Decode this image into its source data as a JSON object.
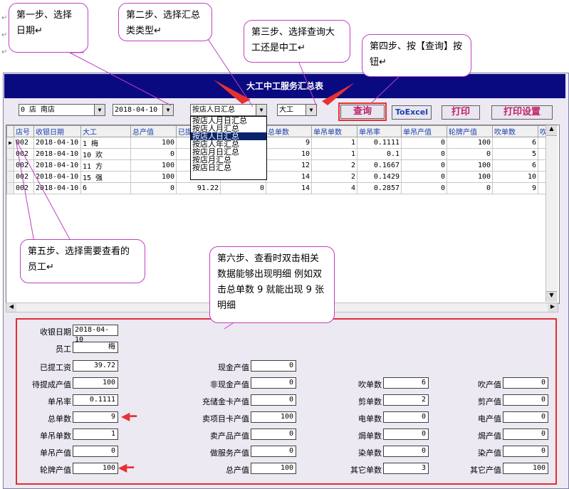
{
  "markers": [
    "↵",
    "↵",
    "↵"
  ],
  "window": {
    "title": "大工中工服务汇总表",
    "store_combo": "0   店 南店",
    "date_combo": "2018-04-10",
    "summary_combo": "按店人日汇总",
    "staff_combo": "大工",
    "buttons": {
      "query": "查询",
      "excel": "ToExcel",
      "print": "打印",
      "print_setup": "打印设置"
    },
    "summary_options": [
      "按店人月日汇总",
      "按店人月汇总",
      "按店人日汇总",
      "按店人年汇总",
      "按店月日汇总",
      "按店月汇总",
      "按店日汇总"
    ]
  },
  "grid": {
    "columns": [
      "店号",
      "收银日期",
      "大工",
      "总产值",
      "已提",
      "",
      "总单数",
      "单吊单数",
      "单吊率",
      "单吊产值",
      "轮牌产值",
      "吹单数",
      "吹"
    ],
    "rows": [
      [
        "002",
        "2018-04-10",
        "1   梅",
        "100",
        "",
        "",
        "9",
        "1",
        "0.1111",
        "0",
        "100",
        "6",
        ""
      ],
      [
        "002",
        "2018-04-10",
        "10  欢",
        "0",
        "",
        "",
        "10",
        "1",
        "0.1",
        "0",
        "0",
        "5",
        ""
      ],
      [
        "002",
        "2018-04-10",
        "11  方",
        "100",
        "",
        "",
        "12",
        "2",
        "0.1667",
        "0",
        "100",
        "6",
        ""
      ],
      [
        "002",
        "2018-04-10",
        "15  强",
        "100",
        "83.44",
        "100",
        "14",
        "2",
        "0.1429",
        "0",
        "100",
        "10",
        ""
      ],
      [
        "002",
        "2018-04-10",
        "6   ",
        "0",
        "91.22",
        "0",
        "14",
        "4",
        "0.2857",
        "0",
        "0",
        "9",
        ""
      ]
    ]
  },
  "detail": {
    "date_label": "收银日期",
    "date_value": "2018-04-10",
    "staff_label": "员工",
    "staff_value": "梅",
    "col1": [
      {
        "label": "已提工资",
        "value": "39.72"
      },
      {
        "label": "待提成产值",
        "value": "100"
      },
      {
        "label": "单吊率",
        "value": "0.1111"
      },
      {
        "label": "总单数",
        "value": "9"
      },
      {
        "label": "单吊单数",
        "value": "1"
      },
      {
        "label": "单吊产值",
        "value": "0"
      },
      {
        "label": "轮牌产值",
        "value": "100"
      }
    ],
    "col2": [
      {
        "label": "现金产值",
        "value": "0"
      },
      {
        "label": "非现金产值",
        "value": "0"
      },
      {
        "label": "充储金卡产值",
        "value": "0"
      },
      {
        "label": "卖项目卡产值",
        "value": "100"
      },
      {
        "label": "卖产品产值",
        "value": "0"
      },
      {
        "label": "做服务产值",
        "value": "0"
      },
      {
        "label": "总产值",
        "value": "100"
      }
    ],
    "col3": [
      {
        "label": "吹单数",
        "value": "6"
      },
      {
        "label": "剪单数",
        "value": "2"
      },
      {
        "label": "电单数",
        "value": "0"
      },
      {
        "label": "焗单数",
        "value": "0"
      },
      {
        "label": "染单数",
        "value": "0"
      },
      {
        "label": "其它单数",
        "value": "3"
      }
    ],
    "col4": [
      {
        "label": "吹产值",
        "value": "0"
      },
      {
        "label": "剪产值",
        "value": "0"
      },
      {
        "label": "电产值",
        "value": "0"
      },
      {
        "label": "焗产值",
        "value": "0"
      },
      {
        "label": "染产值",
        "value": "0"
      },
      {
        "label": "其它产值",
        "value": "100"
      }
    ]
  },
  "callouts": {
    "step1": "第一步、选择日期↵",
    "step2": "第二步、选择汇总类类型↵",
    "step3": "第三步、选择查询大工还是中工↵",
    "step4": "第四步、按【查询】按钮↵",
    "step5": "第五步、选择需要查看的员工↵",
    "step6": "第六步、查看时双击相关数据能够出现明细 例如双击总单数 9 就能出现 9 张明细"
  },
  "colors": {
    "title_bar": "#0a0a80",
    "highlight": "#e83030",
    "callout_border": "#c040c0"
  }
}
